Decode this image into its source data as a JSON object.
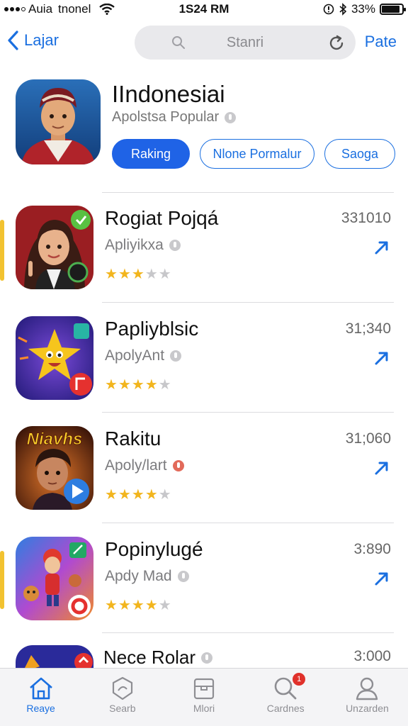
{
  "status_bar": {
    "carrier": "Auia",
    "network": "tnonel",
    "time": "1S24 RM",
    "battery_text": "33%",
    "battery_level": 0.9
  },
  "nav": {
    "back_label": "Lajar",
    "search_placeholder": "Stanri",
    "right_label": "Pate"
  },
  "featured": {
    "title": "IIndonesiai",
    "subtitle": "Apolstsa Popular",
    "chips": [
      {
        "label": "Raking",
        "active": true
      },
      {
        "label": "Nlone Pormalur",
        "active": false
      },
      {
        "label": "Saoga",
        "active": false
      }
    ]
  },
  "apps": [
    {
      "name": "Rogiat Pojqá",
      "subtitle": "Apliyikxa",
      "count": "331010",
      "rating": 3,
      "accent": true
    },
    {
      "name": "Papliyblsic",
      "subtitle": "ApolyAnt",
      "count": "31;340",
      "rating": 4,
      "accent": false
    },
    {
      "name": "Rakitu",
      "subtitle": "Apoly/lart",
      "count": "31;060",
      "rating": 4,
      "accent": false,
      "icon_text": "Niavhs"
    },
    {
      "name": "Popinylugé",
      "subtitle": "Apdy Mad",
      "count": "3:890",
      "rating": 4,
      "accent": true
    },
    {
      "name": "Nece Rolar",
      "count": "3:000"
    }
  ],
  "tabs": [
    {
      "label": "Reaye",
      "icon": "home-icon",
      "active": true
    },
    {
      "label": "Searb",
      "icon": "chat-icon",
      "active": false
    },
    {
      "label": "Mlori",
      "icon": "inbox-icon",
      "active": false
    },
    {
      "label": "Cardnes",
      "icon": "search-icon",
      "active": false,
      "badge": "1"
    },
    {
      "label": "Unzarden",
      "icon": "profile-icon",
      "active": false
    }
  ],
  "colors": {
    "accent": "#1a6fe0",
    "star": "#f2b51d",
    "badge": "#e0312b",
    "rail": "#f2c230"
  }
}
